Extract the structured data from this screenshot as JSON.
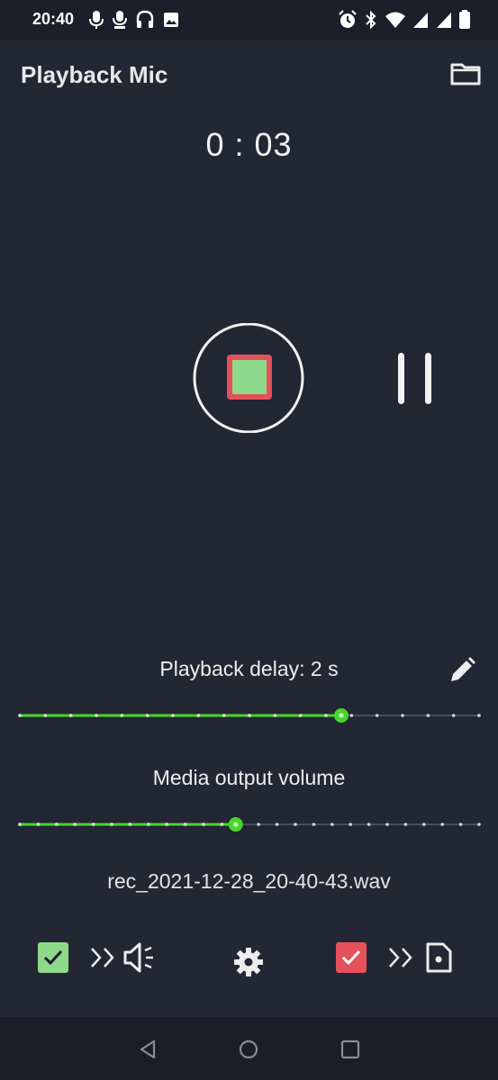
{
  "status_bar": {
    "time": "20:40",
    "left_icons": [
      "mic-icon",
      "mic-alt-icon",
      "headset-icon",
      "image-icon"
    ],
    "right_icons": [
      "alarm-icon",
      "bluetooth-icon",
      "wifi-icon",
      "signal-icon",
      "signal-icon",
      "battery-icon"
    ]
  },
  "app_bar": {
    "title": "Playback Mic",
    "folder_icon": "folder-icon"
  },
  "timer": "0 : 03",
  "controls": {
    "stop_icon": "stop-icon",
    "pause_icon": "pause-icon"
  },
  "playback_delay": {
    "label": "Playback delay: 2 s",
    "edit_icon": "pencil-icon",
    "slider_value": 0.7,
    "slider_steps": 18
  },
  "media_volume": {
    "label": "Media output volume",
    "slider_value": 0.47,
    "slider_steps": 25
  },
  "filename": "rec_2021-12-28_20-40-43.wav",
  "bottom_bar": {
    "speaker_checkbox_checked": true,
    "speaker_icon": "speaker-icon",
    "settings_icon": "gear-icon",
    "file_checkbox_checked": true,
    "file_icon": "sd-card-icon"
  },
  "colors": {
    "background": "#232633",
    "accent_green": "#47d62c",
    "stop_square": "#8fd98a",
    "stop_border": "#e5515b",
    "record_check": "#e5515b"
  },
  "nav_bar": {
    "back_icon": "back-triangle-icon",
    "home_icon": "home-circle-icon",
    "recents_icon": "recents-square-icon"
  }
}
